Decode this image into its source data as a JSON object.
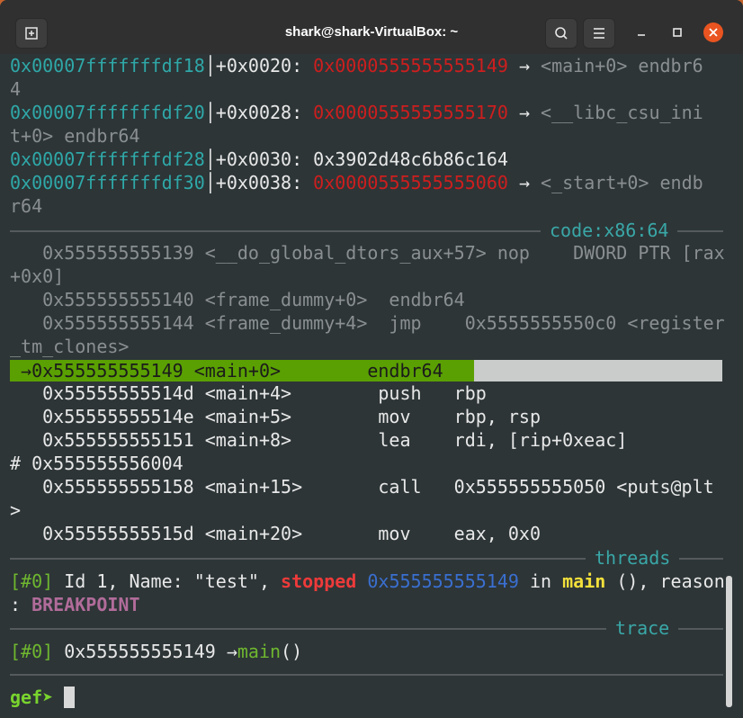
{
  "window": {
    "title": "shark@shark-VirtualBox: ~"
  },
  "stack": [
    {
      "addr": "0x00007fffffffdf18",
      "off": "+0x0020:",
      "val": "0x0000555555555149",
      "arrow": " → ",
      "sym": "<main+0> endbr6",
      "wrap": "4",
      "val_color": "red"
    },
    {
      "addr": "0x00007fffffffdf20",
      "off": "+0x0028:",
      "val": "0x0000555555555170",
      "arrow": " → ",
      "sym": "<__libc_csu_ini",
      "wrap": "t+0> endbr64",
      "val_color": "red"
    },
    {
      "addr": "0x00007fffffffdf28",
      "off": "+0x0030:",
      "val": "0x3902d48c6b86c164",
      "arrow": "",
      "sym": "",
      "wrap": "",
      "val_color": "white"
    },
    {
      "addr": "0x00007fffffffdf30",
      "off": "+0x0038:",
      "val": "0x0000555555555060",
      "arrow": " → ",
      "sym": "<_start+0> endb",
      "wrap": "r64",
      "val_color": "red"
    }
  ],
  "code_header": "code:x86:64",
  "code_gray": [
    "   0x555555555139 <__do_global_dtors_aux+57> nop    DWORD PTR [rax",
    "+0x0]",
    "   0x555555555140 <frame_dummy+0>  endbr64",
    "   0x555555555144 <frame_dummy+4>  jmp    0x5555555550c0 <register",
    "_tm_clones>"
  ],
  "code_current": " →0x555555555149 <main+0>        endbr64",
  "code_next": [
    "   0x55555555514d <main+4>        push   rbp",
    "   0x55555555514e <main+5>        mov    rbp, rsp",
    "   0x555555555151 <main+8>        lea    rdi, [rip+0xeac]",
    "# 0x555555556004",
    "   0x555555555158 <main+15>       call   0x555555555050 <puts@plt",
    ">",
    "   0x55555555515d <main+20>       mov    eax, 0x0"
  ],
  "threads_header": "threads",
  "threads": {
    "idx": "[#0]",
    "text1": " Id 1, Name: \"test\", ",
    "stopped": "stopped",
    "sp": " ",
    "addr": "0x555555555149",
    "in": " in ",
    "fn": "main",
    "rest": " (), reason",
    "line2a": ": ",
    "reason": "BREAKPOINT"
  },
  "trace_header": "trace",
  "trace": {
    "idx": "[#0]",
    "addr": " 0x555555555149 →",
    "fn": "main",
    "rest": "()"
  },
  "prompt": {
    "label": "gef➤ "
  }
}
